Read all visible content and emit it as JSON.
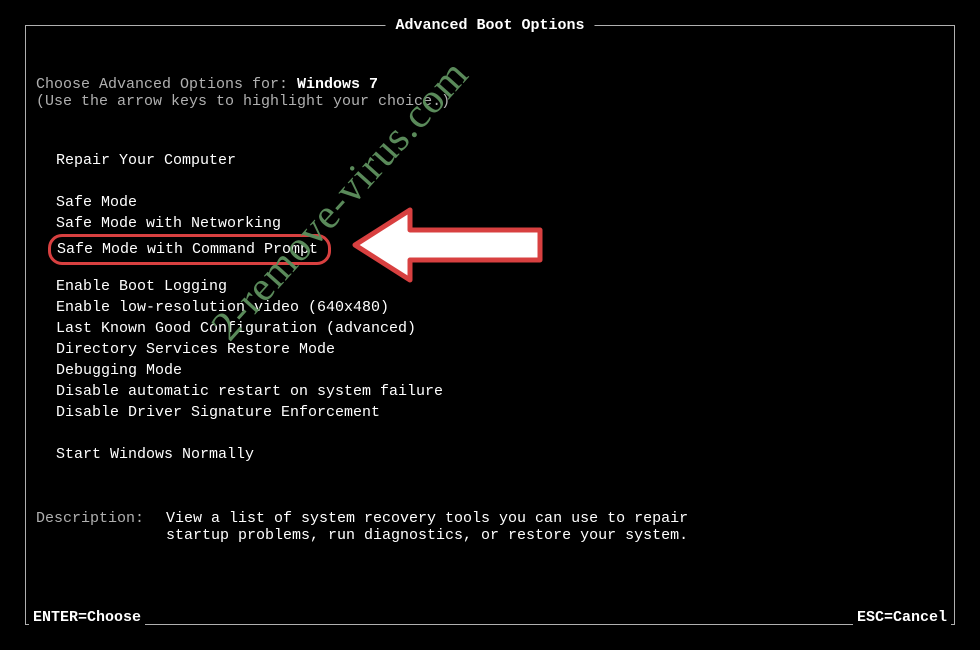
{
  "title": "Advanced Boot Options",
  "intro": {
    "prefix": "Choose Advanced Options for: ",
    "os": "Windows 7",
    "instruction": "(Use the arrow keys to highlight your choice.)"
  },
  "groups": [
    [
      "Repair Your Computer"
    ],
    [
      "Safe Mode",
      "Safe Mode with Networking",
      "Safe Mode with Command Prompt"
    ],
    [
      "Enable Boot Logging",
      "Enable low-resolution video (640x480)",
      "Last Known Good Configuration (advanced)",
      "Directory Services Restore Mode",
      "Debugging Mode",
      "Disable automatic restart on system failure",
      "Disable Driver Signature Enforcement"
    ],
    [
      "Start Windows Normally"
    ]
  ],
  "highlighted_option": "Safe Mode with Command Prompt",
  "description": {
    "label": "Description:",
    "line1": "View a list of system recovery tools you can use to repair",
    "line2": "startup problems, run diagnostics, or restore your system."
  },
  "footer": {
    "enter": "ENTER=Choose",
    "esc": "ESC=Cancel"
  },
  "watermark": "2-remove-virus.com"
}
